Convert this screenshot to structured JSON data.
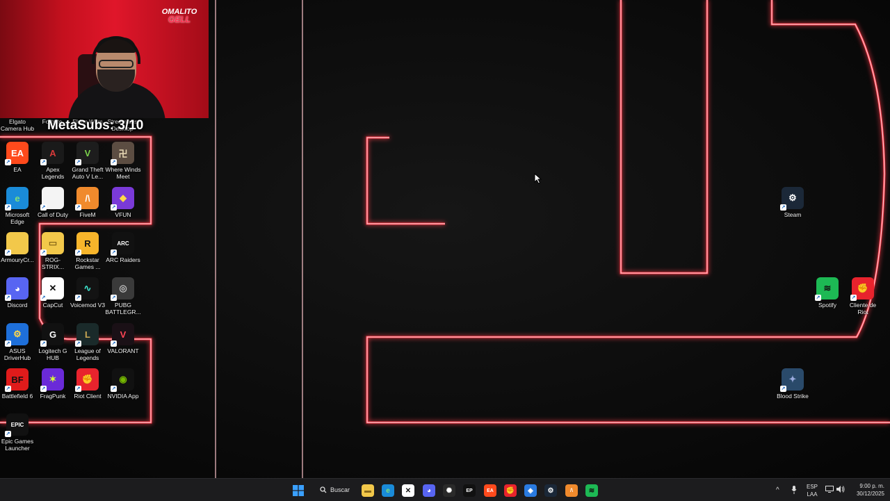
{
  "overlay": {
    "logo_line1": "OMALITO",
    "logo_line2": "GELL",
    "counter": "MetaSubs: 3/10"
  },
  "header_row": [
    "Elgato Camera Hub",
    "Fortnite",
    "Elden Wars",
    "Streamlabs Desktop"
  ],
  "desktop_left": [
    {
      "label": "EA",
      "icon": "ea-icon",
      "bg": "#ff4a1c",
      "glyph": "EA",
      "color": "#fff"
    },
    {
      "label": "Apex Legends",
      "icon": "apex-icon",
      "bg": "#1a1a1a",
      "glyph": "A",
      "color": "#d83a3a"
    },
    {
      "label": "Grand Theft Auto V Le...",
      "icon": "gta-icon",
      "bg": "#1d1d1d",
      "glyph": "V",
      "color": "#7bd14b"
    },
    {
      "label": "Where Winds Meet",
      "icon": "wwm-icon",
      "bg": "#5c4d42",
      "glyph": "卍",
      "color": "#e8d9b5"
    },
    {
      "label": "Microsoft Edge",
      "icon": "edge-icon",
      "bg": "#1a8bd8",
      "glyph": "e",
      "color": "#7fe07a"
    },
    {
      "label": "Call of Duty",
      "icon": "file-icon",
      "bg": "#f4f4f4",
      "glyph": "",
      "color": "#888"
    },
    {
      "label": "FiveM",
      "icon": "fivem-icon",
      "bg": "#f08a2c",
      "glyph": "/\\",
      "color": "#fff"
    },
    {
      "label": "VFUN",
      "icon": "vfun-icon",
      "bg": "#7a3ad8",
      "glyph": "◆",
      "color": "#ffd84a"
    },
    {
      "label": "ArmouryCr...",
      "icon": "folder-icon",
      "bg": "#f2c84a",
      "glyph": "",
      "color": "#fff"
    },
    {
      "label": "ROG-STRIX...",
      "icon": "folder-icon",
      "bg": "#f2c84a",
      "glyph": "▭",
      "color": "#8a6a1a"
    },
    {
      "label": "Rockstar Games ...",
      "icon": "rockstar-icon",
      "bg": "#f7b52b",
      "glyph": "R",
      "color": "#111"
    },
    {
      "label": "ARC Raiders",
      "icon": "arc-icon",
      "bg": "#111",
      "glyph": "ARC",
      "color": "#fff"
    },
    {
      "label": "Discord",
      "icon": "discord-icon",
      "bg": "#5865f2",
      "glyph": "◕",
      "color": "#fff"
    },
    {
      "label": "CapCut",
      "icon": "capcut-icon",
      "bg": "#fff",
      "glyph": "✕",
      "color": "#111"
    },
    {
      "label": "Voicemod V3",
      "icon": "voicemod-icon",
      "bg": "#131313",
      "glyph": "∿",
      "color": "#3ee6d0"
    },
    {
      "label": "PUBG BATTLEGR...",
      "icon": "pubg-icon",
      "bg": "#3a3a3a",
      "glyph": "◎",
      "color": "#bdbdbd"
    },
    {
      "label": "ASUS DriverHub",
      "icon": "asus-icon",
      "bg": "#1e6fd9",
      "glyph": "⚙",
      "color": "#ffd84a"
    },
    {
      "label": "Logitech G HUB",
      "icon": "logitech-icon",
      "bg": "#111",
      "glyph": "G",
      "color": "#fff"
    },
    {
      "label": "League of Legends",
      "icon": "lol-icon",
      "bg": "#1a2a2a",
      "glyph": "L",
      "color": "#c9a753"
    },
    {
      "label": "VALORANT",
      "icon": "valorant-icon",
      "bg": "#1a1016",
      "glyph": "V",
      "color": "#ff4655"
    },
    {
      "label": "Battlefield 6",
      "icon": "bf6-icon",
      "bg": "#e01b1b",
      "glyph": "BF",
      "color": "#111"
    },
    {
      "label": "FragPunk",
      "icon": "fragpunk-icon",
      "bg": "#6a2ad8",
      "glyph": "✶",
      "color": "#d8ff3a"
    },
    {
      "label": "Riot Client",
      "icon": "riot-icon",
      "bg": "#e8232d",
      "glyph": "✊",
      "color": "#fff"
    },
    {
      "label": "NVIDIA App",
      "icon": "nvidia-icon",
      "bg": "#111",
      "glyph": "◉",
      "color": "#76b900"
    },
    {
      "label": "Epic Games Launcher",
      "icon": "epic-icon",
      "bg": "#111",
      "glyph": "EPIC",
      "color": "#fff"
    }
  ],
  "desktop_right": [
    {
      "label": "Steam",
      "icon": "steam-icon",
      "bg": "#1b2838",
      "glyph": "⚙",
      "color": "#fff"
    },
    {
      "label": "Spotify",
      "icon": "spotify-icon",
      "bg": "#1db954",
      "glyph": "≋",
      "color": "#111"
    },
    {
      "label": "Cliente de Riot",
      "icon": "riot-icon",
      "bg": "#e8232d",
      "glyph": "✊",
      "color": "#fff"
    },
    {
      "label": "Blood Strike",
      "icon": "bloodstrike-icon",
      "bg": "#2a4a6a",
      "glyph": "✦",
      "color": "#9ad"
    }
  ],
  "taskbar": {
    "search_label": "Buscar",
    "apps": [
      {
        "icon": "file-explorer-icon",
        "bg": "#f2c84a",
        "glyph": "▬",
        "color": "#8a6a1a"
      },
      {
        "icon": "edge-icon",
        "bg": "#1a8bd8",
        "glyph": "e",
        "color": "#7fe07a"
      },
      {
        "icon": "capcut-icon",
        "bg": "#fff",
        "glyph": "✕",
        "color": "#111"
      },
      {
        "icon": "discord-icon",
        "bg": "#5865f2",
        "glyph": "◕",
        "color": "#fff"
      },
      {
        "icon": "chatgpt-icon",
        "bg": "#2a2a2a",
        "glyph": "✺",
        "color": "#fff"
      },
      {
        "icon": "epic-icon",
        "bg": "#111",
        "glyph": "EP",
        "color": "#fff"
      },
      {
        "icon": "ea-icon",
        "bg": "#ff4a1c",
        "glyph": "EA",
        "color": "#fff"
      },
      {
        "icon": "riot-icon",
        "bg": "#e8232d",
        "glyph": "✊",
        "color": "#fff"
      },
      {
        "icon": "copilot-icon",
        "bg": "#2a7be0",
        "glyph": "◈",
        "color": "#fff"
      },
      {
        "icon": "steam-icon",
        "bg": "#1b2838",
        "glyph": "⚙",
        "color": "#fff"
      },
      {
        "icon": "fivem-icon",
        "bg": "#f08a2c",
        "glyph": "/\\",
        "color": "#fff"
      },
      {
        "icon": "spotify-icon",
        "bg": "#1db954",
        "glyph": "≋",
        "color": "#111"
      }
    ],
    "lang_top": "ESP",
    "lang_bottom": "LAA",
    "time": "9:00 p. m.",
    "date": "30/12/2025"
  }
}
